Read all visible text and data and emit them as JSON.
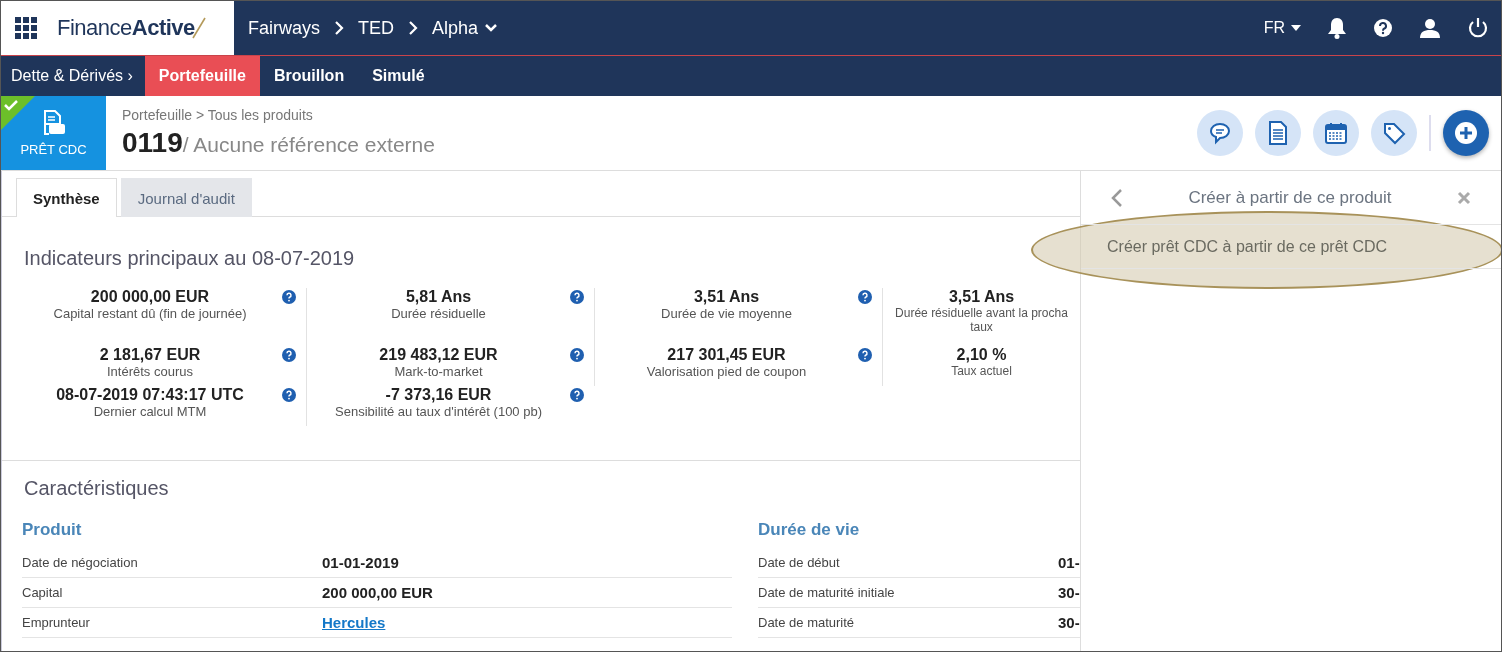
{
  "brand": {
    "plain": "Finance",
    "bold": "Active"
  },
  "context": {
    "path": [
      "Fairways",
      "TED"
    ],
    "current": "Alpha"
  },
  "language": "FR",
  "menu": [
    {
      "label": "Dette & Dérivés ›",
      "kind": "section",
      "selected": false
    },
    {
      "label": "Portefeuille",
      "kind": "tab",
      "selected": true
    },
    {
      "label": "Brouillon",
      "kind": "tab",
      "selected": false
    },
    {
      "label": "Simulé",
      "kind": "tab",
      "selected": false
    }
  ],
  "product": {
    "type_label": "PRÊT CDC",
    "validated": true,
    "breadcrumb": "Portefeuille > Tous les produits",
    "number": "0119",
    "reference": "/ Aucune référence externe"
  },
  "tabs": [
    {
      "label": "Synthèse",
      "selected": true
    },
    {
      "label": "Journal d'audit",
      "selected": false
    }
  ],
  "indicators": {
    "title": "Indicateurs principaux au 08-07-2019",
    "rows": [
      [
        {
          "value": "200 000,00 EUR",
          "label": "Capital restant dû (fin de journée)",
          "help": true
        },
        {
          "value": "5,81 Ans",
          "label": "Durée résiduelle",
          "help": true
        },
        {
          "value": "3,51 Ans",
          "label": "Durée de vie moyenne",
          "help": true
        },
        {
          "value": "3,51 Ans",
          "label": "Durée résiduelle avant la procha taux",
          "help": false
        }
      ],
      [
        {
          "value": "2 181,67 EUR",
          "label": "Intérêts courus",
          "help": true
        },
        {
          "value": "219 483,12 EUR",
          "label": "Mark-to-market",
          "help": true
        },
        {
          "value": "217 301,45 EUR",
          "label": "Valorisation pied de coupon",
          "help": true
        },
        {
          "value": "2,10 %",
          "label": "Taux actuel",
          "help": false
        }
      ],
      [
        {
          "value": "08-07-2019 07:43:17 UTC",
          "label": "Dernier calcul MTM",
          "help": true
        },
        {
          "value": "-7 373,16 EUR",
          "label": "Sensibilité au taux d'intérêt (100 pb)",
          "help": true
        }
      ]
    ]
  },
  "characteristics": {
    "title": "Caractéristiques",
    "sections": [
      {
        "title": "Produit",
        "rows": [
          {
            "label": "Date de négociation",
            "value": "01-01-2019",
            "kind": "text"
          },
          {
            "label": "Capital",
            "value": "200 000,00 EUR",
            "kind": "text"
          },
          {
            "label": "Emprunteur",
            "value": "Hercules",
            "kind": "link"
          }
        ]
      },
      {
        "title": "Durée de vie",
        "rows": [
          {
            "label": "Date de début",
            "value": "01-",
            "kind": "text"
          },
          {
            "label": "Date de maturité initiale",
            "value": "30-",
            "kind": "text"
          },
          {
            "label": "Date de maturité",
            "value": "30-",
            "kind": "text"
          }
        ]
      }
    ]
  },
  "side_panel": {
    "title": "Créer à partir de ce produit",
    "items": [
      {
        "label": "Créer prêt CDC à partir de ce prêt CDC",
        "highlighted": true
      }
    ]
  }
}
